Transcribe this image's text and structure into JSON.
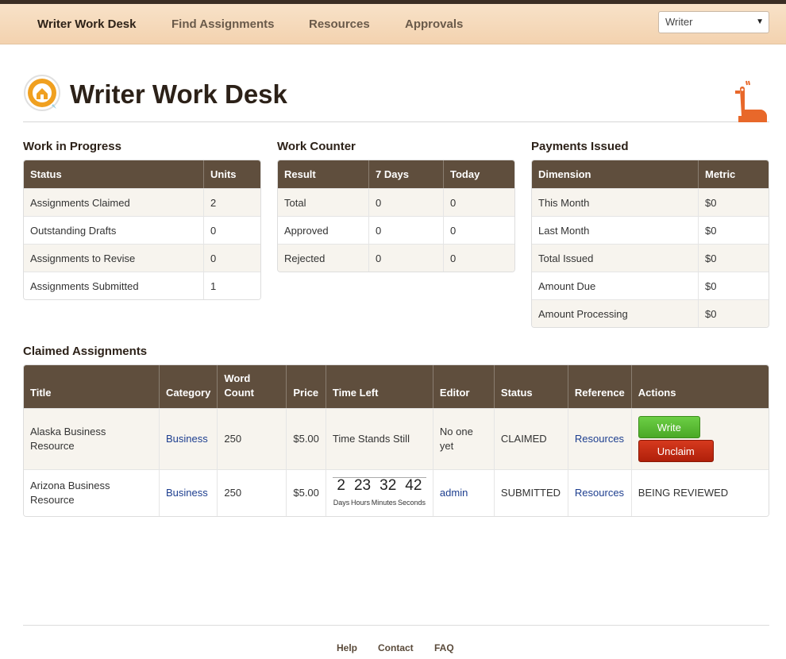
{
  "nav": {
    "items": [
      "Writer Work Desk",
      "Find Assignments",
      "Resources",
      "Approvals"
    ],
    "role_select": "Writer"
  },
  "header": {
    "title": "Writer Work Desk"
  },
  "wip": {
    "title": "Work in Progress",
    "columns": [
      "Status",
      "Units"
    ],
    "rows": [
      [
        "Assignments Claimed",
        "2"
      ],
      [
        "Outstanding Drafts",
        "0"
      ],
      [
        "Assignments to Revise",
        "0"
      ],
      [
        "Assignments Submitted",
        "1"
      ]
    ]
  },
  "counter": {
    "title": "Work Counter",
    "columns": [
      "Result",
      "7 Days",
      "Today"
    ],
    "rows": [
      [
        "Total",
        "0",
        "0"
      ],
      [
        "Approved",
        "0",
        "0"
      ],
      [
        "Rejected",
        "0",
        "0"
      ]
    ]
  },
  "payments": {
    "title": "Payments Issued",
    "columns": [
      "Dimension",
      "Metric"
    ],
    "rows": [
      [
        "This Month",
        "$0"
      ],
      [
        "Last Month",
        "$0"
      ],
      [
        "Total Issued",
        "$0"
      ],
      [
        "Amount Due",
        "$0"
      ],
      [
        "Amount Processing",
        "$0"
      ]
    ]
  },
  "claimed": {
    "title": "Claimed Assignments",
    "columns": [
      "Title",
      "Category",
      "Word Count",
      "Price",
      "Time Left",
      "Editor",
      "Status",
      "Reference",
      "Actions"
    ],
    "rows": [
      {
        "title": "Alaska Business Resource",
        "category": "Business",
        "word_count": "250",
        "price": "$5.00",
        "time_left": "Time Stands Still",
        "editor": "No one yet",
        "status": "CLAIMED",
        "reference": "Resources",
        "write_label": "Write",
        "unclaim_label": "Unclaim"
      },
      {
        "title": "Arizona Business Resource",
        "category": "Business",
        "word_count": "250",
        "price": "$5.00",
        "countdown": {
          "days": "2",
          "hours": "23",
          "minutes": "32",
          "seconds": "42",
          "labels": [
            "Days",
            "Hours",
            "Minutes",
            "Seconds"
          ]
        },
        "editor": "admin",
        "status": "SUBMITTED",
        "reference": "Resources",
        "action_text": "BEING REVIEWED"
      }
    ]
  },
  "footer": {
    "links": [
      "Help",
      "Contact",
      "FAQ"
    ]
  },
  "colors": {
    "header_bg": "#5f4e3d",
    "accent_orange": "#e8682a",
    "nav_bg": "#f5d8b8",
    "write_green": "#4aa826",
    "unclaim_red": "#b0200a",
    "link_blue": "#1d3e8f"
  }
}
